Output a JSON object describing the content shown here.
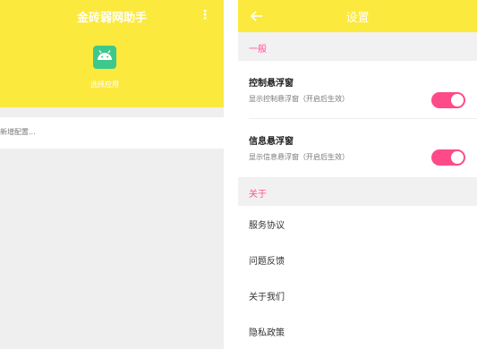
{
  "left_screen": {
    "title": "金砖弱网助手",
    "menu_icon": "more-vert-icon",
    "app_picker": {
      "icon": "android-icon",
      "label": "选择应用"
    },
    "add_config_label": "新增配置..."
  },
  "right_screen": {
    "title": "设置",
    "back_icon": "arrow-back-icon",
    "sections": [
      {
        "header": "一般",
        "items": [
          {
            "title": "控制悬浮窗",
            "description": "显示控制悬浮窗（开启后生效）",
            "enabled": true
          },
          {
            "title": "信息悬浮窗",
            "description": "显示信息悬浮窗（开启后生效）",
            "enabled": true
          }
        ]
      },
      {
        "header": "关于",
        "items": [
          {
            "label": "服务协议"
          },
          {
            "label": "问题反馈"
          },
          {
            "label": "关于我们"
          },
          {
            "label": "隐私政策"
          }
        ]
      }
    ]
  },
  "colors": {
    "primary_yellow": "#fce93e",
    "accent_pink": "#ff4a8a",
    "android_green": "#3fc88b",
    "section_bg": "#f1f1f1"
  }
}
